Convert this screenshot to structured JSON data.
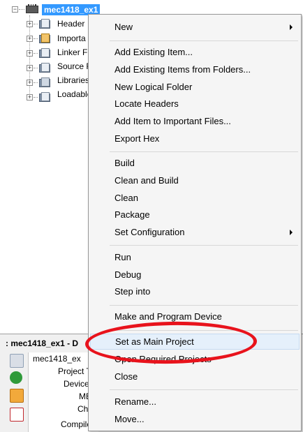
{
  "project": {
    "name": "mec1418_ex1",
    "nodes": [
      {
        "label": "Header",
        "icon": "folder-icon"
      },
      {
        "label": "Importa",
        "icon": "important-files-folder-icon"
      },
      {
        "label": "Linker Fi",
        "icon": "folder-icon"
      },
      {
        "label": "Source F",
        "icon": "folder-icon"
      },
      {
        "label": "Libraries",
        "icon": "libraries-folder-icon"
      },
      {
        "label": "Loadable",
        "icon": "folder-icon"
      }
    ]
  },
  "dashboard": {
    "title": ": mec1418_ex1 - D",
    "rows": [
      {
        "label": "mec1418_ex"
      },
      {
        "label": "Project T"
      },
      {
        "label": "Device"
      },
      {
        "label": "ME"
      },
      {
        "label": "Ch"
      },
      {
        "label": "Compile"
      }
    ]
  },
  "context_menu": {
    "groups": [
      [
        {
          "label": "New",
          "submenu": true
        }
      ],
      [
        {
          "label": "Add Existing Item..."
        },
        {
          "label": "Add Existing Items from Folders..."
        },
        {
          "label": "New Logical Folder"
        },
        {
          "label": "Locate Headers"
        },
        {
          "label": "Add Item to Important Files..."
        },
        {
          "label": "Export Hex"
        }
      ],
      [
        {
          "label": "Build"
        },
        {
          "label": "Clean and Build"
        },
        {
          "label": "Clean"
        },
        {
          "label": "Package"
        },
        {
          "label": "Set Configuration",
          "submenu": true
        }
      ],
      [
        {
          "label": "Run"
        },
        {
          "label": "Debug"
        },
        {
          "label": "Step into"
        }
      ],
      [
        {
          "label": "Make and Program Device"
        }
      ],
      [
        {
          "label": "Set as Main Project",
          "highlighted": true
        },
        {
          "label": "Open Required Projects"
        },
        {
          "label": "Close"
        }
      ],
      [
        {
          "label": "Rename..."
        },
        {
          "label": "Move..."
        }
      ]
    ]
  },
  "colors": {
    "selection": "#3399ff",
    "annotation": "#e8131c",
    "menu_background": "#f5f5f5",
    "highlight": "#e5f0fb"
  }
}
